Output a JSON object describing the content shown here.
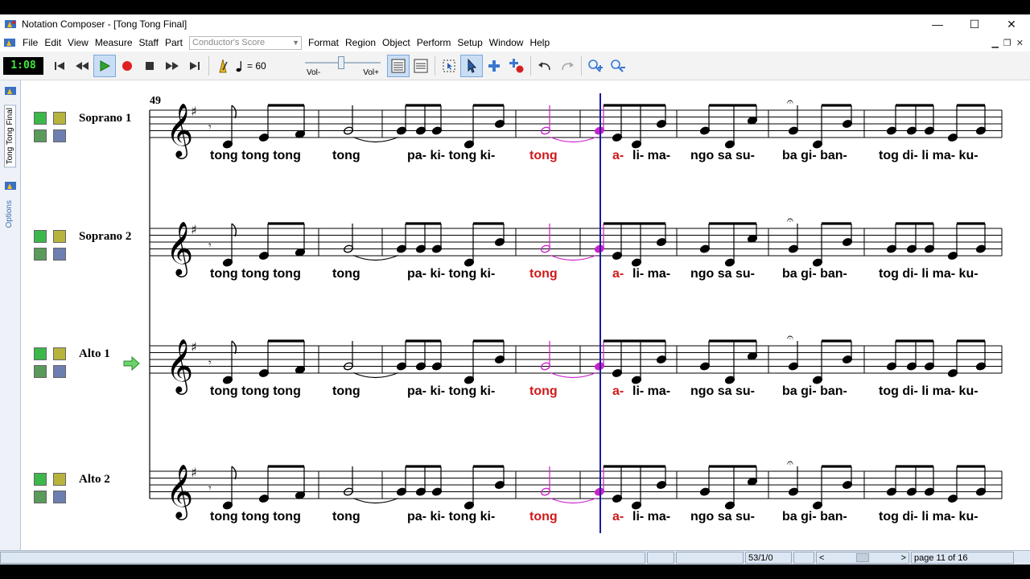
{
  "window": {
    "title": "Notation Composer - [Tong Tong Final]",
    "minimize": "—",
    "maximize": "☐",
    "close": "✕"
  },
  "menu": {
    "file": "File",
    "edit": "Edit",
    "view": "View",
    "measure": "Measure",
    "staff": "Staff",
    "part": "Part",
    "part_select_value": "Conductor's Score",
    "format": "Format",
    "region": "Region",
    "object": "Object",
    "perform": "Perform",
    "setup": "Setup",
    "window": "Window",
    "help": "Help"
  },
  "toolbar": {
    "timer": "1:08",
    "tempo": "= 60",
    "vol_minus": "Vol-",
    "vol_plus": "Vol+",
    "vol_level": 0.48
  },
  "sidetabs": {
    "document": "Tong Tong Final",
    "options": "Options"
  },
  "score": {
    "measure_number": "49",
    "staves": [
      {
        "name": "Soprano 1"
      },
      {
        "name": "Soprano 2"
      },
      {
        "name": "Alto 1"
      },
      {
        "name": "Alto 2"
      }
    ],
    "lyrics": [
      {
        "text": "tong tong tong",
        "red": false
      },
      {
        "text": "tong",
        "red": false
      },
      {
        "text": "pa- ki- tong ki-",
        "red": false
      },
      {
        "text": "tong",
        "red": true
      },
      {
        "text": "a-",
        "red": true
      },
      {
        "text": "li- ma-",
        "red": false
      },
      {
        "text": "ngo sa su-",
        "red": false
      },
      {
        "text": "ba gi- ban-",
        "red": false
      },
      {
        "text": "tog di- li ma- ku-",
        "red": false
      }
    ]
  },
  "status": {
    "position": "53/1/0",
    "scroll_left": "<",
    "scroll_right": ">",
    "page": "page 11 of 16"
  },
  "colors": {
    "playback_cursor": "#1a1a9c",
    "highlight_note": "#cc22cc",
    "timer_text": "#3eea3e",
    "red_lyric": "#d01a1a"
  }
}
